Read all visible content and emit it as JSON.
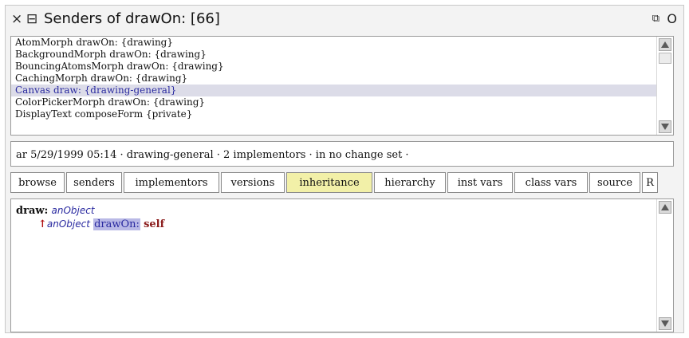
{
  "window": {
    "title": "Senders of drawOn: [66]",
    "icons": {
      "close": "close-icon",
      "menu": "menu-icon",
      "collapse": "collapse-icon",
      "expand": "expand-icon"
    }
  },
  "list": {
    "items": [
      "AtomMorph drawOn: {drawing}",
      "BackgroundMorph drawOn: {drawing}",
      "BouncingAtomsMorph drawOn: {drawing}",
      "CachingMorph drawOn: {drawing}",
      "Canvas draw: {drawing-general}",
      "ColorPickerMorph drawOn: {drawing}",
      "DisplayText composeForm {private}"
    ],
    "selected_index": 4
  },
  "info": {
    "text": "ar 5/29/1999 05:14 · drawing-general · 2 implementors · in no change set ·"
  },
  "buttons": [
    "browse",
    "senders",
    "implementors",
    "versions",
    "inheritance",
    "hierarchy",
    "inst vars",
    "class vars",
    "source",
    "R"
  ],
  "active_button": "inheritance",
  "code": {
    "selector": "draw:",
    "arg": "anObject",
    "caret": "↑",
    "arg2": "anObject",
    "message": "drawOn:",
    "receiver": "self"
  },
  "colors": {
    "selection": "#dcdce8",
    "active_button": "#f2f0a8",
    "highlight": "#b9b9e6"
  }
}
